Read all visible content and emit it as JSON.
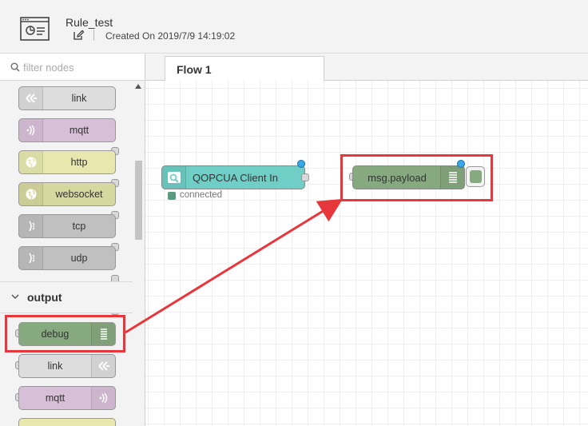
{
  "header": {
    "title": "Rule_test",
    "created_on": "Created On 2019/7/9 14:19:02"
  },
  "palette": {
    "filter_placeholder": "filter nodes",
    "input_nodes": [
      {
        "label": "link",
        "color": "#dddddd",
        "icon": "link-icon"
      },
      {
        "label": "mqtt",
        "color": "#d8bfd8",
        "icon": "mqtt-icon"
      },
      {
        "label": "http",
        "color": "#e7e7ae",
        "icon": "globe-icon"
      },
      {
        "label": "websocket",
        "color": "#d7d7a0",
        "icon": "globe-icon"
      },
      {
        "label": "tcp",
        "color": "#c0c0c0",
        "icon": "bridge-icon"
      },
      {
        "label": "udp",
        "color": "#c0c0c0",
        "icon": "bridge-icon"
      }
    ],
    "category_output": "output",
    "output_nodes": [
      {
        "label": "debug",
        "color": "#87a980",
        "icon": "debug-icon"
      },
      {
        "label": "link",
        "color": "#dddddd",
        "icon": "link-icon"
      },
      {
        "label": "mqtt",
        "color": "#d8bfd8",
        "icon": "mqtt-icon"
      }
    ]
  },
  "workspace": {
    "tab_label": "Flow 1",
    "nodes": {
      "opcua": {
        "label": "QOPCUA Client In",
        "color": "#6fcfc6",
        "status": "connected",
        "status_color": "#5a9a82"
      },
      "debug": {
        "label": "msg.payload",
        "color": "#87a980"
      }
    }
  },
  "annotation": {
    "color": "#e8373c"
  }
}
